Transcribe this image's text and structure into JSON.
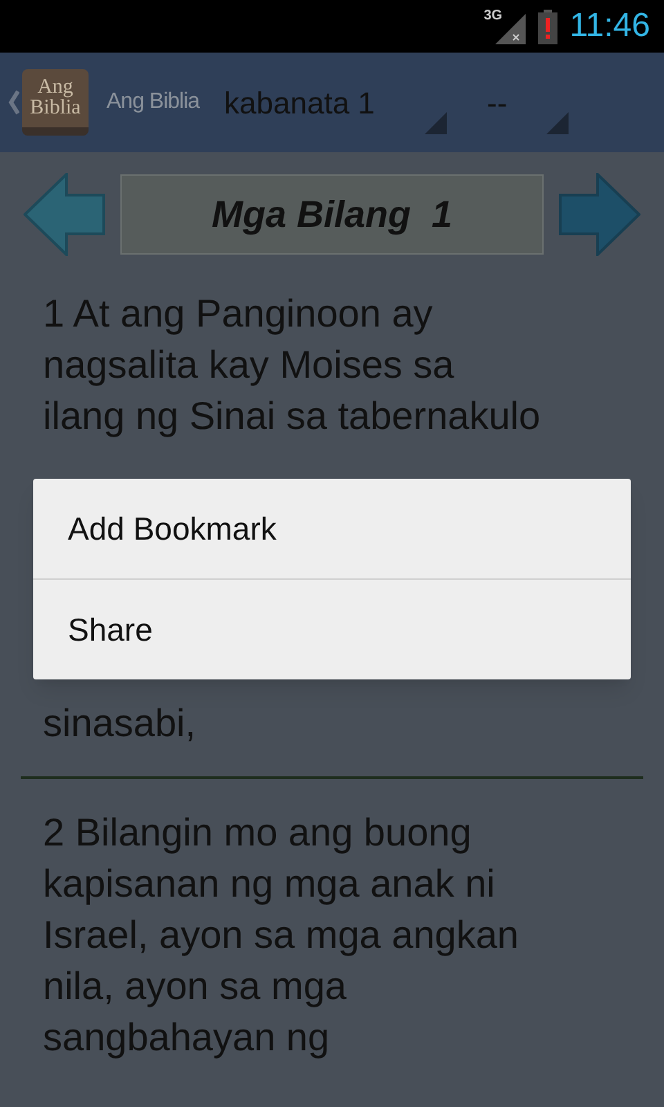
{
  "status_bar": {
    "network": "3G",
    "time": "11:46"
  },
  "action_bar": {
    "logo_text": [
      "Ang",
      "Biblia"
    ],
    "app_title": "Ang Biblia",
    "chapter_spinner": "kabanata 1",
    "verse_spinner": "--"
  },
  "chapter_header": {
    "title": "Mga Bilang  1"
  },
  "verses": [
    {
      "lines_above": [
        "1 At ang Panginoon ay",
        "nagsalita kay Moises sa",
        "ilang ng Sinai sa tabernakulo"
      ],
      "lines_below": [
        "sinasabi,"
      ]
    },
    {
      "lines_above": [
        "2 Bilangin mo ang buong",
        "kapisanan ng mga anak ni",
        "Israel, ayon sa mga angkan",
        "nila, ayon sa mga",
        "sangbahayan ng"
      ]
    }
  ],
  "context_menu": {
    "items": [
      "Add Bookmark",
      "Share"
    ]
  }
}
